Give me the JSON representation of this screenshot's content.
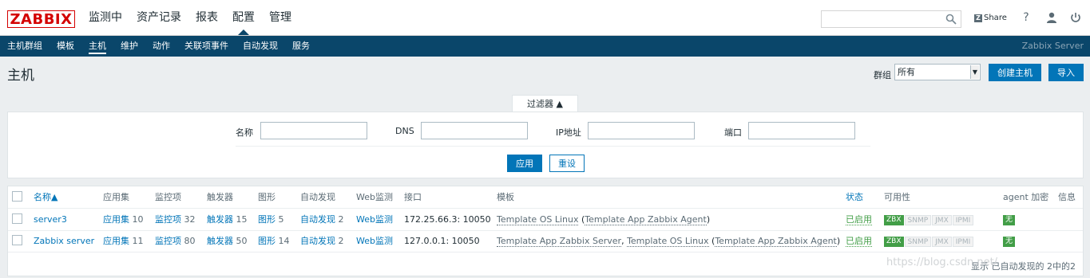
{
  "header": {
    "logo": "ZABBIX",
    "nav": [
      "监测中",
      "资产记录",
      "报表",
      "配置",
      "管理"
    ],
    "active_nav": "配置",
    "share_label": "Share",
    "help_icon": "?"
  },
  "subnav": {
    "items": [
      "主机群组",
      "模板",
      "主机",
      "维护",
      "动作",
      "关联项事件",
      "自动发现",
      "服务"
    ],
    "active": "主机",
    "server": "Zabbix Server"
  },
  "page": {
    "title": "主机",
    "group_label": "群组",
    "group_value": "所有",
    "create_button": "创建主机",
    "import_button": "导入"
  },
  "filter": {
    "tab_label": "过滤器 ▲",
    "name_label": "名称",
    "dns_label": "DNS",
    "ip_label": "IP地址",
    "port_label": "端口",
    "apply_button": "应用",
    "reset_button": "重设"
  },
  "table": {
    "headers": {
      "name": "名称▲",
      "apps": "应用集",
      "items": "监控项",
      "triggers": "触发器",
      "graphs": "图形",
      "discovery": "自动发现",
      "web": "Web监测",
      "interface": "接口",
      "templates": "模板",
      "status": "状态",
      "availability": "可用性",
      "agent_enc": "agent 加密",
      "info": "信息"
    },
    "rows": [
      {
        "name": "server3",
        "apps_label": "应用集",
        "apps_count": "10",
        "items_label": "监控项",
        "items_count": "32",
        "triggers_label": "触发器",
        "triggers_count": "15",
        "graphs_label": "图形",
        "graphs_count": "5",
        "discovery_label": "自动发现",
        "discovery_count": "2",
        "web_label": "Web监测",
        "interface": "172.25.66.3: 10050",
        "tpl_main": "Template OS Linux",
        "tpl_open": " (",
        "tpl_sub1": "Template App Zabbix Agent",
        "tpl_close": ")",
        "status": "已启用",
        "avail": [
          "ZBX",
          "SNMP",
          "JMX",
          "IPMI"
        ],
        "encryption": "无"
      },
      {
        "name": "Zabbix server",
        "apps_label": "应用集",
        "apps_count": "11",
        "items_label": "监控项",
        "items_count": "80",
        "triggers_label": "触发器",
        "triggers_count": "50",
        "graphs_label": "图形",
        "graphs_count": "14",
        "discovery_label": "自动发现",
        "discovery_count": "2",
        "web_label": "Web监测",
        "interface": "127.0.0.1: 10050",
        "tpl_main": "Template App Zabbix Server",
        "tpl_sep": ", ",
        "tpl_main2": "Template OS Linux",
        "tpl_open": " (",
        "tpl_sub1": "Template App Zabbix Agent",
        "tpl_close": ")",
        "status": "已启用",
        "avail": [
          "ZBX",
          "SNMP",
          "JMX",
          "IPMI"
        ],
        "encryption": "无"
      }
    ],
    "footer": "显示 已自动发现的 2中的2"
  },
  "watermark": "https://blog.csdn.net/",
  "colors": {
    "brand": "#d40000",
    "nav_bg": "#0a466a",
    "link": "#0275b8",
    "enabled": "#429e47"
  },
  "icons": [
    "search-icon",
    "share-icon",
    "help-icon",
    "user-icon",
    "power-icon",
    "chevron-down-icon",
    "sort-up-icon"
  ]
}
